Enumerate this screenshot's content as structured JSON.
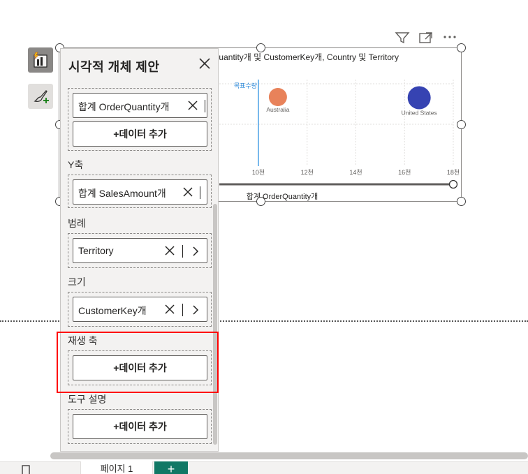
{
  "visual": {
    "title": "합계 SalesAmount개, 합계 OrderQuantity개 및 CustomerKey개, Country 및 Territory",
    "header_icons": [
      "filter-icon",
      "focus-mode-icon",
      "more-options-icon"
    ]
  },
  "chart_data": {
    "type": "scatter",
    "xlabel": "합계 OrderQuantity개",
    "x_ticks": [
      "10천",
      "12천",
      "14천",
      "16천",
      "18천"
    ],
    "xlim": [
      8,
      18
    ],
    "reference_line": {
      "label": "목표수량",
      "x": 10
    },
    "points": [
      {
        "label": "Australia",
        "x": 10.8,
        "color": "#E8825A",
        "size": "small"
      },
      {
        "label": "United States",
        "x": 16.6,
        "color": "#3643B2",
        "size": "large"
      }
    ]
  },
  "pane": {
    "title": "시각적 개체 제안",
    "sections": [
      {
        "label": "",
        "chip": "합계 OrderQuantity개",
        "add": "+데이터 추가"
      },
      {
        "label": "Y축",
        "chip": "합계 SalesAmount개"
      },
      {
        "label": "범례",
        "chip": "Territory"
      },
      {
        "label": "크기",
        "chip": "CustomerKey개"
      },
      {
        "label": "재생 축",
        "add": "+데이터 추가"
      },
      {
        "label": "도구 설명",
        "add": "+데이터 추가"
      }
    ]
  },
  "bottom": {
    "page_tab": "페이지 1",
    "add_page": "+"
  }
}
